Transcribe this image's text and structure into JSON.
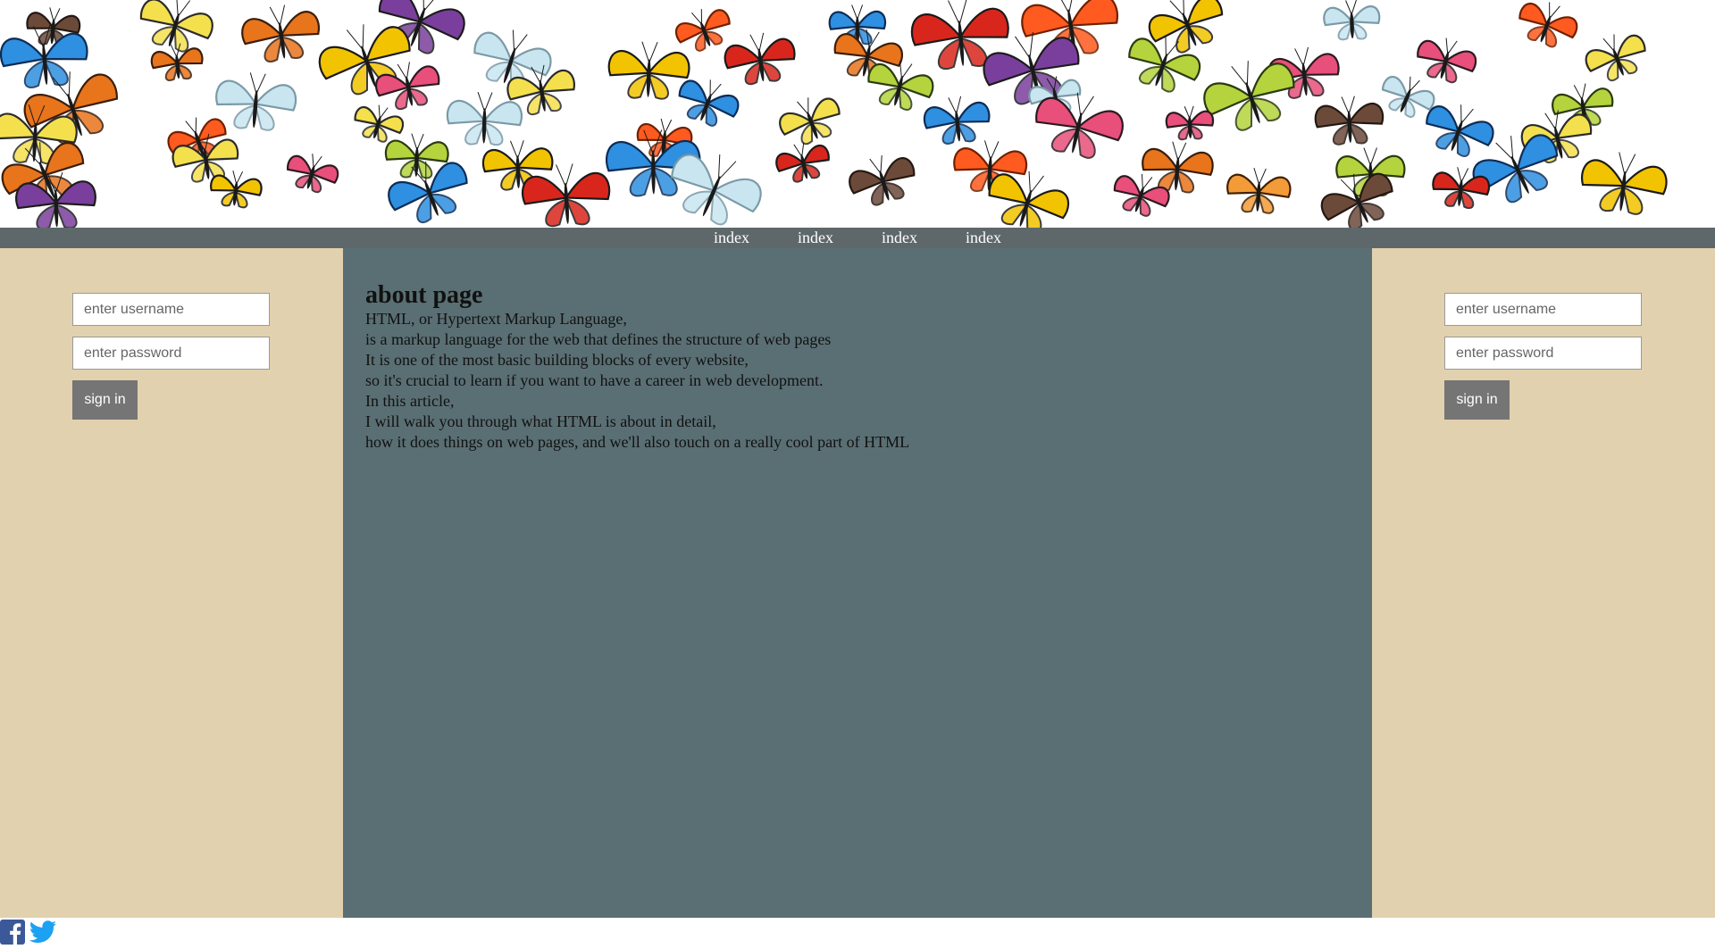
{
  "nav": {
    "items": [
      "index",
      "index",
      "index",
      "index"
    ]
  },
  "left_login": {
    "username_placeholder": "enter username",
    "password_placeholder": "enter password",
    "button_label": "sign in"
  },
  "right_login": {
    "username_placeholder": "enter username",
    "password_placeholder": "enter password",
    "button_label": "sign in"
  },
  "main": {
    "title": "about page",
    "lines": [
      "HTML, or Hypertext Markup Language,",
      "is a markup language for the web that defines the structure of web pages",
      "It is one of the most basic building blocks of every website,",
      "so it's crucial to learn if you want to have a career in web development.",
      "In this article,",
      "I will walk you through what HTML is about in detail,",
      "how it does things on web pages, and we'll also touch on a really cool part of HTML"
    ]
  },
  "footer": {
    "icons": [
      "facebook-icon",
      "twitter-icon"
    ]
  },
  "colors": {
    "nav_bg": "#5e686b",
    "side_bg": "#e1d1ae",
    "main_bg": "#5a6f74",
    "button_bg": "#757575",
    "facebook": "#3b5998",
    "twitter": "#1da1f2"
  }
}
